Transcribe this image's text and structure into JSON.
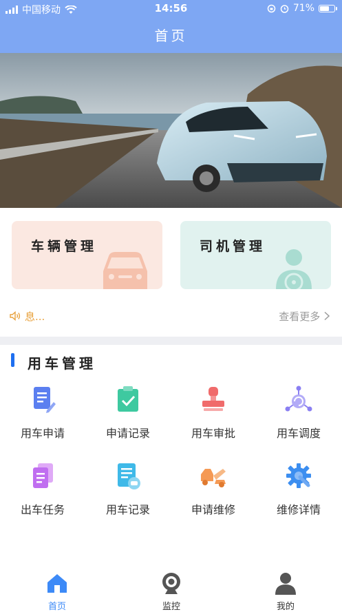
{
  "status": {
    "carrier": "中国移动",
    "time": "14:56",
    "battery": "71%",
    "battery_level": 0.71
  },
  "nav": {
    "title": "首页"
  },
  "cards": {
    "vehicle": {
      "label": "车辆管理",
      "icon": "car-icon"
    },
    "driver": {
      "label": "司机管理",
      "icon": "driver-icon"
    }
  },
  "notice": {
    "text": "息...",
    "more": "查看更多"
  },
  "section": {
    "title": "用车管理",
    "items": [
      {
        "label": "用车申请",
        "icon": "document-edit-icon",
        "color": "#5b7ff0"
      },
      {
        "label": "申请记录",
        "icon": "clipboard-check-icon",
        "color": "#3ec9a0"
      },
      {
        "label": "用车审批",
        "icon": "stamp-icon",
        "color": "#f06b6b"
      },
      {
        "label": "用车调度",
        "icon": "dispatch-icon",
        "color": "#8a7ff2"
      },
      {
        "label": "出车任务",
        "icon": "task-docs-icon",
        "color": "#c06ef0"
      },
      {
        "label": "用车记录",
        "icon": "car-record-icon",
        "color": "#3fb9e8"
      },
      {
        "label": "申请维修",
        "icon": "tow-truck-icon",
        "color": "#f59a55"
      },
      {
        "label": "维修详情",
        "icon": "gear-wrench-icon",
        "color": "#3c8ef0"
      }
    ]
  },
  "tabbar": {
    "items": [
      {
        "label": "首页",
        "icon": "home-icon",
        "active": true
      },
      {
        "label": "监控",
        "icon": "camera-icon",
        "active": false
      },
      {
        "label": "我的",
        "icon": "user-icon",
        "active": false
      }
    ],
    "active_color": "#3d8af7",
    "inactive_color": "#333333"
  }
}
